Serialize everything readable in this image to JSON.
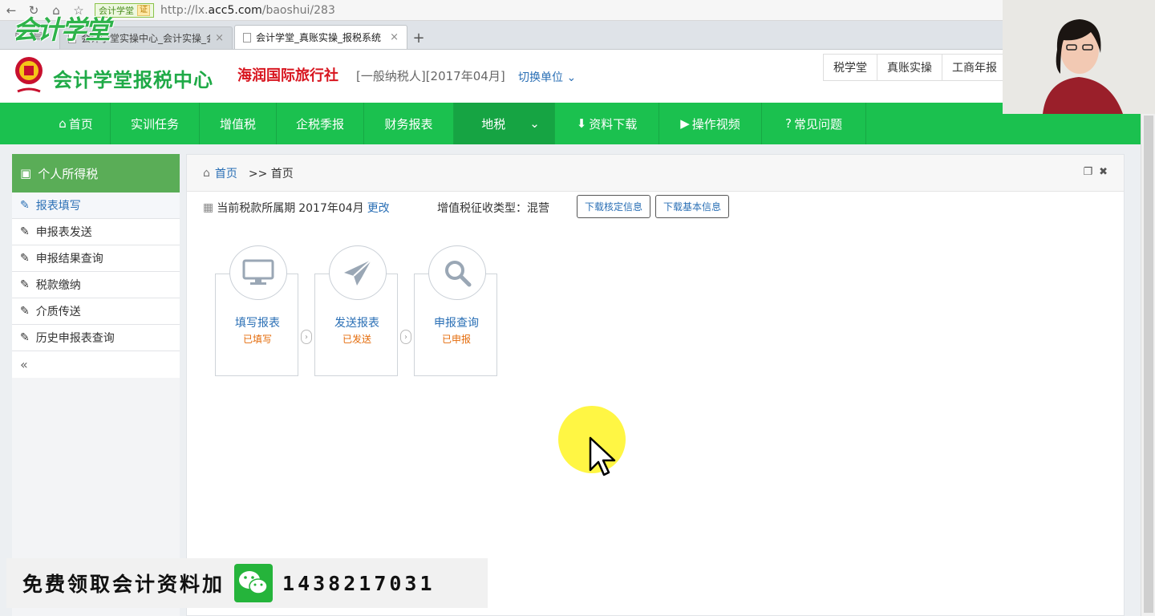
{
  "browser": {
    "cert_label": "会计学堂",
    "cert_badge": "证",
    "url_prefix": "http://lx.",
    "url_domain": "acc5.com",
    "url_path": "/baoshui/283",
    "tabs": [
      {
        "label": "会计学堂实操中心_会计实操_会计",
        "active": false
      },
      {
        "label": "会计学堂_真账实操_报税系统",
        "active": true
      }
    ],
    "watermark": "会计学堂"
  },
  "header": {
    "site_title": "会计学堂报税中心",
    "company": "海润国际旅行社",
    "company_meta": "[一般纳税人][2017年04月]",
    "switch_unit": "切换单位",
    "top_links": [
      "税学堂",
      "真账实操",
      "工商年报"
    ]
  },
  "nav": {
    "items": [
      {
        "label": "首页",
        "icon": "home-icon"
      },
      {
        "label": "实训任务"
      },
      {
        "label": "增值税"
      },
      {
        "label": "企税季报"
      },
      {
        "label": "财务报表"
      },
      {
        "label": "地税",
        "active": true
      },
      {
        "label": "资料下载",
        "icon": "download-icon"
      },
      {
        "label": "操作视频",
        "icon": "play-icon"
      },
      {
        "label": "常见问题",
        "icon": "question-icon"
      }
    ]
  },
  "sidebar": {
    "title": "个人所得税",
    "items": [
      {
        "label": "报表填写",
        "active": true
      },
      {
        "label": "申报表发送"
      },
      {
        "label": "申报结果查询"
      },
      {
        "label": "税款缴纳"
      },
      {
        "label": "介质传送"
      },
      {
        "label": "历史申报表查询"
      }
    ],
    "collapse": "«"
  },
  "content": {
    "breadcrumb_home": "首页",
    "breadcrumb_current": ">> 首页",
    "period_label": "当前税款所属期",
    "period_value": "2017年04月",
    "period_change": "更改",
    "vat_type": "增值税征收类型：混营",
    "btn_download_verify": "下载核定信息",
    "btn_download_basic": "下载基本信息",
    "steps": [
      {
        "title": "填写报表",
        "status": "已填写",
        "icon": "monitor-icon"
      },
      {
        "title": "发送报表",
        "status": "已发送",
        "icon": "paper-plane-icon"
      },
      {
        "title": "申报查询",
        "status": "已申报",
        "icon": "search-icon"
      }
    ]
  },
  "promo": {
    "text": "免费领取会计资料加",
    "number": "1438217031"
  },
  "colors": {
    "brand_green": "#1bc14f",
    "sidebar_green": "#5aad57",
    "company_red": "#d8151f",
    "link_blue": "#2a6fb5",
    "status_orange": "#e46b0a"
  }
}
